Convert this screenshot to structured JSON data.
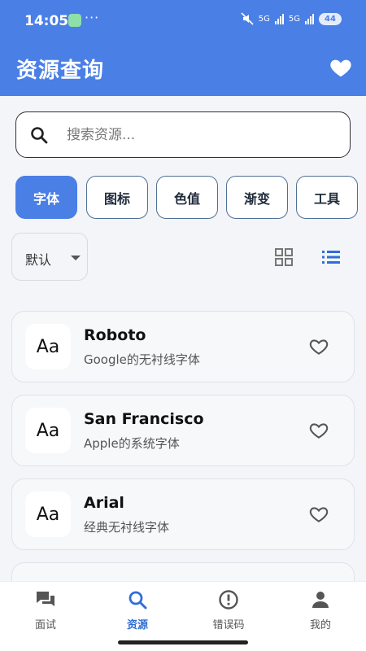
{
  "status_bar": {
    "time": "14:05",
    "network_1": "5G",
    "network_2": "5G",
    "battery": "44"
  },
  "header": {
    "title": "资源查询"
  },
  "search": {
    "placeholder": "搜索资源..."
  },
  "categories": [
    {
      "label": "字体",
      "active": true
    },
    {
      "label": "图标",
      "active": false
    },
    {
      "label": "色值",
      "active": false
    },
    {
      "label": "渐变",
      "active": false
    },
    {
      "label": "工具",
      "active": false
    }
  ],
  "sort": {
    "selected": "默认"
  },
  "view_mode": "list",
  "resources": [
    {
      "thumb": "Aa",
      "name": "Roboto",
      "desc": "Google的无衬线字体"
    },
    {
      "thumb": "Aa",
      "name": "San Francisco",
      "desc": "Apple的系统字体"
    },
    {
      "thumb": "Aa",
      "name": "Arial",
      "desc": "经典无衬线字体"
    }
  ],
  "bottom_nav": [
    {
      "label": "面试",
      "icon": "chat-icon",
      "active": false
    },
    {
      "label": "资源",
      "icon": "search-icon",
      "active": true
    },
    {
      "label": "错误码",
      "icon": "alert-circle-icon",
      "active": false
    },
    {
      "label": "我的",
      "icon": "person-icon",
      "active": false
    }
  ],
  "colors": {
    "primary": "#4a7fe6",
    "active_nav": "#2f6fd6",
    "background": "#f4f5f8"
  }
}
